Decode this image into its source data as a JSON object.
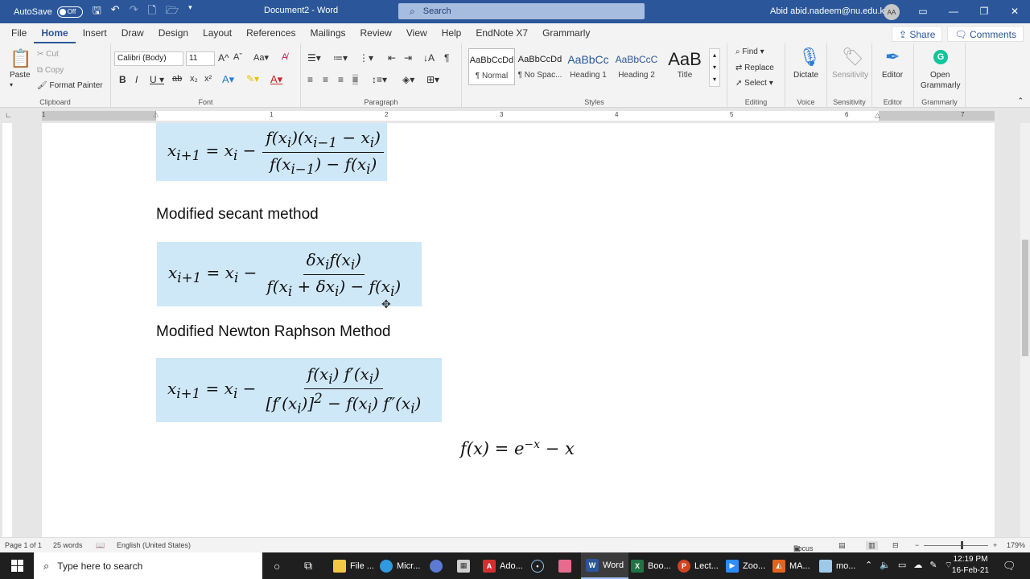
{
  "titlebar": {
    "autosave_label": "AutoSave",
    "autosave_state": "Off",
    "doc_title": "Document2 - Word",
    "search_placeholder": "Search",
    "user": "Abid abid.nadeem@nu.edu.kz",
    "avatar_initials": "AA"
  },
  "tabs": [
    {
      "label": "File"
    },
    {
      "label": "Home"
    },
    {
      "label": "Insert"
    },
    {
      "label": "Draw"
    },
    {
      "label": "Design"
    },
    {
      "label": "Layout"
    },
    {
      "label": "References"
    },
    {
      "label": "Mailings"
    },
    {
      "label": "Review"
    },
    {
      "label": "View"
    },
    {
      "label": "Help"
    },
    {
      "label": "EndNote X7"
    },
    {
      "label": "Grammarly"
    }
  ],
  "tab_actions": {
    "share": "Share",
    "comments": "Comments"
  },
  "ribbon": {
    "clipboard": {
      "paste": "Paste",
      "cut": "Cut",
      "copy": "Copy",
      "format_painter": "Format Painter",
      "label": "Clipboard"
    },
    "font": {
      "family": "Calibri (Body)",
      "size": "11",
      "label": "Font"
    },
    "paragraph": {
      "label": "Paragraph"
    },
    "styles": {
      "items": [
        {
          "preview": "AaBbCcDd",
          "name": "¶ Normal"
        },
        {
          "preview": "AaBbCcDd",
          "name": "¶ No Spac..."
        },
        {
          "preview": "AaBbCc",
          "name": "Heading 1"
        },
        {
          "preview": "AaBbCcC",
          "name": "Heading 2"
        },
        {
          "preview": "AaB",
          "name": "Title"
        }
      ],
      "label": "Styles"
    },
    "editing": {
      "find": "Find",
      "replace": "Replace",
      "select": "Select",
      "label": "Editing"
    },
    "voice": {
      "dictate": "Dictate",
      "label": "Voice"
    },
    "sensitivity": {
      "button": "Sensitivity",
      "label": "Sensitivity"
    },
    "editor": {
      "button": "Editor",
      "label": "Editor"
    },
    "grammarly": {
      "button_line1": "Open",
      "button_line2": "Grammarly",
      "label": "Grammarly"
    }
  },
  "ruler_numbers": [
    "1",
    "1",
    "2",
    "3",
    "4",
    "5",
    "6",
    "7"
  ],
  "document": {
    "heading_secant": "Modified secant method",
    "heading_newton": "Modified Newton Raphson Method",
    "eq1": {
      "lhs": "x_{i+1} = x_i −",
      "num": "f(x_i)(x_{i−1} − x_i)",
      "den": "f(x_{i−1}) − f(x_i)"
    },
    "eq2": {
      "lhs": "x_{i+1} = x_i −",
      "num": "δx_i f(x_i)",
      "den": "f(x_i + δx_i) − f(x_i)"
    },
    "eq3": {
      "lhs": "x_{i+1} = x_i −",
      "num": "f(x_i) f′(x_i)",
      "den": "[f′(x_i)]² − f(x_i) f″(x_i)"
    },
    "function": "f(x) = e^{−x} − x"
  },
  "statusbar": {
    "page": "Page 1 of 1",
    "words": "25 words",
    "language": "English (United States)",
    "focus": "Focus",
    "zoom": "179%"
  },
  "taskbar": {
    "search_placeholder": "Type here to search",
    "items": [
      {
        "label": "File ...",
        "icon": "folder-icon",
        "color": "#f2c744"
      },
      {
        "label": "Micr...",
        "icon": "edge-icon",
        "color": "#2f9ae0"
      },
      {
        "label": "",
        "icon": "app-icon",
        "color": "#5b7bd5"
      },
      {
        "label": "",
        "icon": "calculator-icon",
        "color": "#cfcfcf"
      },
      {
        "label": "Ado...",
        "icon": "acrobat-icon",
        "color": "#d32f2f"
      },
      {
        "label": "",
        "icon": "record-icon",
        "color": "#8bc4f2"
      },
      {
        "label": "",
        "icon": "snip-icon",
        "color": "#e66b8c"
      },
      {
        "label": "Word",
        "icon": "word-icon",
        "color": "#2b579a"
      },
      {
        "label": "Boo...",
        "icon": "excel-icon",
        "color": "#217346"
      },
      {
        "label": "Lect...",
        "icon": "powerpoint-icon",
        "color": "#d04423"
      },
      {
        "label": "Zoo...",
        "icon": "zoom-icon",
        "color": "#2d8cff"
      },
      {
        "label": "MA...",
        "icon": "matlab-icon",
        "color": "#e2641f"
      },
      {
        "label": "mo...",
        "icon": "notepad-icon",
        "color": "#9ec9e8"
      }
    ],
    "time": "12:19 PM",
    "date": "16-Feb-21"
  }
}
